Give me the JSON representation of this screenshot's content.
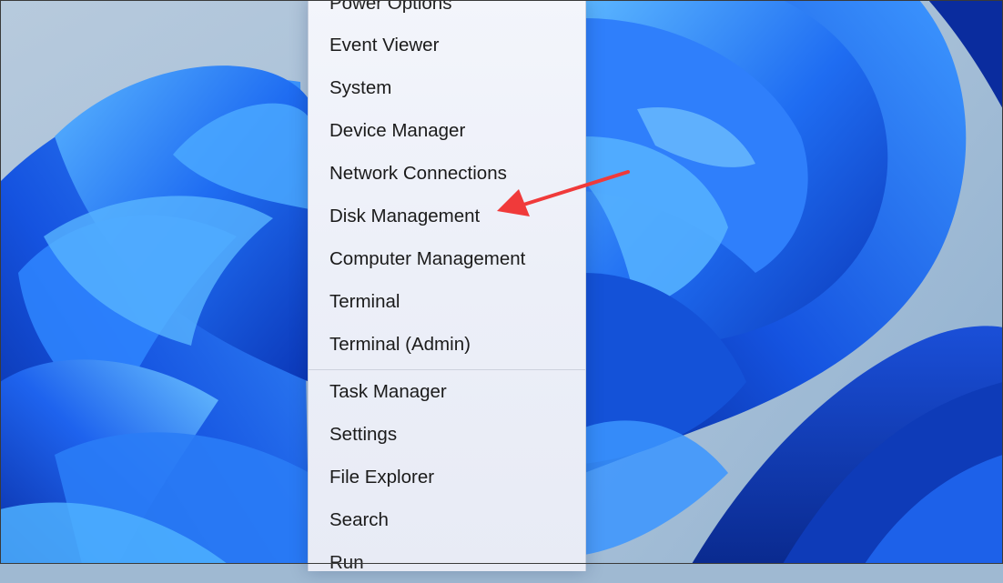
{
  "context_menu": {
    "items_top": [
      {
        "label": "Power Options",
        "name": "menu-item-power-options"
      },
      {
        "label": "Event Viewer",
        "name": "menu-item-event-viewer"
      },
      {
        "label": "System",
        "name": "menu-item-system"
      },
      {
        "label": "Device Manager",
        "name": "menu-item-device-manager"
      },
      {
        "label": "Network Connections",
        "name": "menu-item-network-connections"
      },
      {
        "label": "Disk Management",
        "name": "menu-item-disk-management"
      },
      {
        "label": "Computer Management",
        "name": "menu-item-computer-management"
      },
      {
        "label": "Terminal",
        "name": "menu-item-terminal"
      },
      {
        "label": "Terminal (Admin)",
        "name": "menu-item-terminal-admin"
      }
    ],
    "items_bottom": [
      {
        "label": "Task Manager",
        "name": "menu-item-task-manager"
      },
      {
        "label": "Settings",
        "name": "menu-item-settings"
      },
      {
        "label": "File Explorer",
        "name": "menu-item-file-explorer"
      },
      {
        "label": "Search",
        "name": "menu-item-search"
      },
      {
        "label": "Run",
        "name": "menu-item-run"
      }
    ]
  },
  "annotation": {
    "arrow_color": "#f03a3a",
    "points_to": "Disk Management"
  },
  "wallpaper": {
    "theme": "windows-11-bloom",
    "accent": "#1a5cf0",
    "background": "#9fb9d2"
  }
}
